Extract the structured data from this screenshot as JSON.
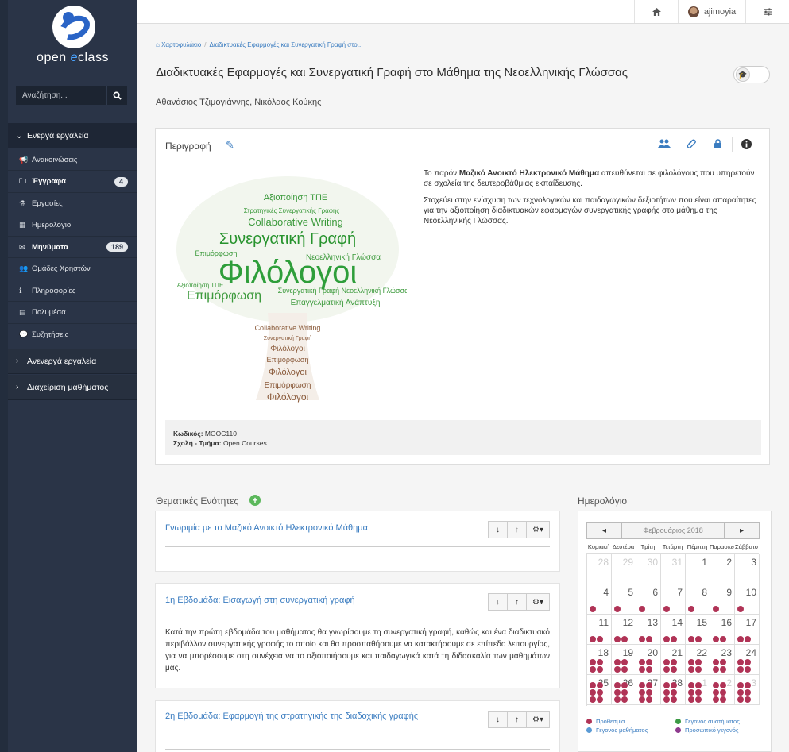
{
  "brand": {
    "name_a": "open ",
    "name_b": "e",
    "name_c": "class"
  },
  "search": {
    "placeholder": "Αναζήτηση..."
  },
  "sidebar": {
    "active_header": "Ενεργά εργαλεία",
    "items": [
      {
        "label": "Ανακοινώσεις",
        "icon": "bullhorn-icon"
      },
      {
        "label": "Έγγραφα",
        "icon": "folder-icon",
        "badge": "4",
        "bold": true
      },
      {
        "label": "Εργασίες",
        "icon": "flask-icon"
      },
      {
        "label": "Ημερολόγιο",
        "icon": "calendar-icon"
      },
      {
        "label": "Μηνύματα",
        "icon": "envelope-icon",
        "badge": "189",
        "bold": true
      },
      {
        "label": "Ομάδες Χρηστών",
        "icon": "users-icon"
      },
      {
        "label": "Πληροφορίες",
        "icon": "info-icon"
      },
      {
        "label": "Πολυμέσα",
        "icon": "film-icon"
      },
      {
        "label": "Συζητήσεις",
        "icon": "comments-icon"
      }
    ],
    "inactive_header": "Ανενεργά εργαλεία",
    "admin_header": "Διαχείριση μαθήματος"
  },
  "topbar": {
    "username": "ajimoyia"
  },
  "breadcrumb": {
    "home": "Χαρτοφυλάκιο",
    "current": "Διαδικτυακές Εφαρμογές και Συνεργατική Γραφή στο..."
  },
  "course": {
    "title": "Διαδικτυακές Εφαρμογές και Συνεργατική Γραφή στο Μάθημα της Νεοελληνικής Γλώσσας",
    "authors": "Αθανάσιος Τζιμογιάννης, Νικόλαος Κούκης"
  },
  "description": {
    "heading": "Περιγραφή",
    "p1_pre": "Το παρόν ",
    "p1_bold": "Μαζικό Ανοικτό Ηλεκτρονικό Μάθημα",
    "p1_post": " απευθύνεται σε φιλολόγους που υπηρετούν σε σχολεία της δευτεροβάθμιας εκπαίδευσης.",
    "p2": "Στοχεύει στην ενίσχυση των τεχνολογικών και παιδαγωγικών δεξιοτήτων που είναι απαραίτητες για την αξιοποίηση διαδικτυακών εφαρμογών συνεργατικής γραφής στο μάθημα της Νεοελληνικής Γλώσσας.",
    "code_label": "Κωδικός:",
    "code": "MOOC110",
    "dept_label": "Σχολή - Τμήμα:",
    "dept": "Open Courses"
  },
  "wordcloud": {
    "words_green": [
      "Αξιοποίηση ΤΠΕ",
      "Στρατηγικές Συνεργατικής Γραφής",
      "Collaborative Writing",
      "Συνεργατική Γραφή",
      "Επιμόρφωση",
      "Φιλόλογοι",
      "Νεοελληνική Γλώσσα",
      "Συνεργατική Γραφή Νεοελληνική Γλώσσα",
      "Επιμόρφωση",
      "Επαγγελματική Ανάπτυξη",
      "Αξιοποίηση ΤΠΕ"
    ],
    "words_brown": [
      "Collaborative Writing",
      "Συνεργατική Γραφή",
      "Φιλόλογοι",
      "Επιμόρφωση",
      "Φιλόλογοι",
      "Επιμόρφωση",
      "Φιλόλογοι"
    ]
  },
  "units_section": {
    "title": "Θεματικές Ενότητες"
  },
  "units": [
    {
      "title": "Γνωριμία με το Μαζικό Ανοικτό Ηλεκτρονικό Μάθημα",
      "body": ""
    },
    {
      "title": "1η Εβδομάδα: Εισαγωγή στη συνεργατική γραφή",
      "body": "Κατά την πρώτη εβδομάδα του μαθήματος θα γνωρίσουμε τη συνεργατική γραφή, καθώς και ένα διαδικτυακό περιβάλλον συνεργατικής γραφής το οποίο και θα προσπαθήσουμε να κατακτήσουμε σε επίπεδο λειτουργίας, για να μπορέσουμε στη συνέχεια να το αξιοποιήσουμε και παιδαγωγικά κατά τη διδασκαλία των μαθημάτων μας."
    },
    {
      "title": "2η Εβδομάδα: Εφαρμογή της στρατηγικής της διαδοχικής γραφής",
      "body": ""
    }
  ],
  "calendar": {
    "title": "Ημερολόγιο",
    "month": "Φεβρουάριος 2018",
    "days": [
      "Κυριακή",
      "Δευτέρα",
      "Τρίτη",
      "Τετάρτη",
      "Πέμπτη",
      "Παρασκευή",
      "Σάββατο"
    ],
    "weeks": [
      [
        {
          "d": "28",
          "o": true,
          "e": 0
        },
        {
          "d": "29",
          "o": true,
          "e": 0
        },
        {
          "d": "30",
          "o": true,
          "e": 0
        },
        {
          "d": "31",
          "o": true,
          "e": 0
        },
        {
          "d": "1",
          "e": 0
        },
        {
          "d": "2",
          "e": 0
        },
        {
          "d": "3",
          "e": 0
        }
      ],
      [
        {
          "d": "4",
          "e": 1
        },
        {
          "d": "5",
          "e": 1
        },
        {
          "d": "6",
          "e": 1
        },
        {
          "d": "7",
          "e": 1
        },
        {
          "d": "8",
          "e": 1
        },
        {
          "d": "9",
          "e": 1
        },
        {
          "d": "10",
          "e": 1
        }
      ],
      [
        {
          "d": "11",
          "e": 2
        },
        {
          "d": "12",
          "e": 2
        },
        {
          "d": "13",
          "e": 2
        },
        {
          "d": "14",
          "e": 2
        },
        {
          "d": "15",
          "e": 2
        },
        {
          "d": "16",
          "e": 2
        },
        {
          "d": "17",
          "e": 2
        }
      ],
      [
        {
          "d": "18",
          "e": 4
        },
        {
          "d": "19",
          "e": 4
        },
        {
          "d": "20",
          "e": 4
        },
        {
          "d": "21",
          "e": 4
        },
        {
          "d": "22",
          "e": 4
        },
        {
          "d": "23",
          "e": 4
        },
        {
          "d": "24",
          "e": 4
        }
      ],
      [
        {
          "d": "25",
          "e": 6
        },
        {
          "d": "26",
          "e": 6
        },
        {
          "d": "27",
          "e": 6
        },
        {
          "d": "28",
          "e": 6
        },
        {
          "d": "1",
          "o": true,
          "e": 6
        },
        {
          "d": "2",
          "o": true,
          "e": 6
        },
        {
          "d": "3",
          "o": true,
          "e": 6
        }
      ]
    ],
    "legend": [
      {
        "label": "Προθεσμία",
        "color": "#b03356"
      },
      {
        "label": "Γεγονός συστήματος",
        "color": "#3c9a45"
      },
      {
        "label": "Γεγονός μαθήματος",
        "color": "#5b9bd5"
      },
      {
        "label": "Προσωπικό γεγονός",
        "color": "#8e3a8e"
      }
    ]
  }
}
